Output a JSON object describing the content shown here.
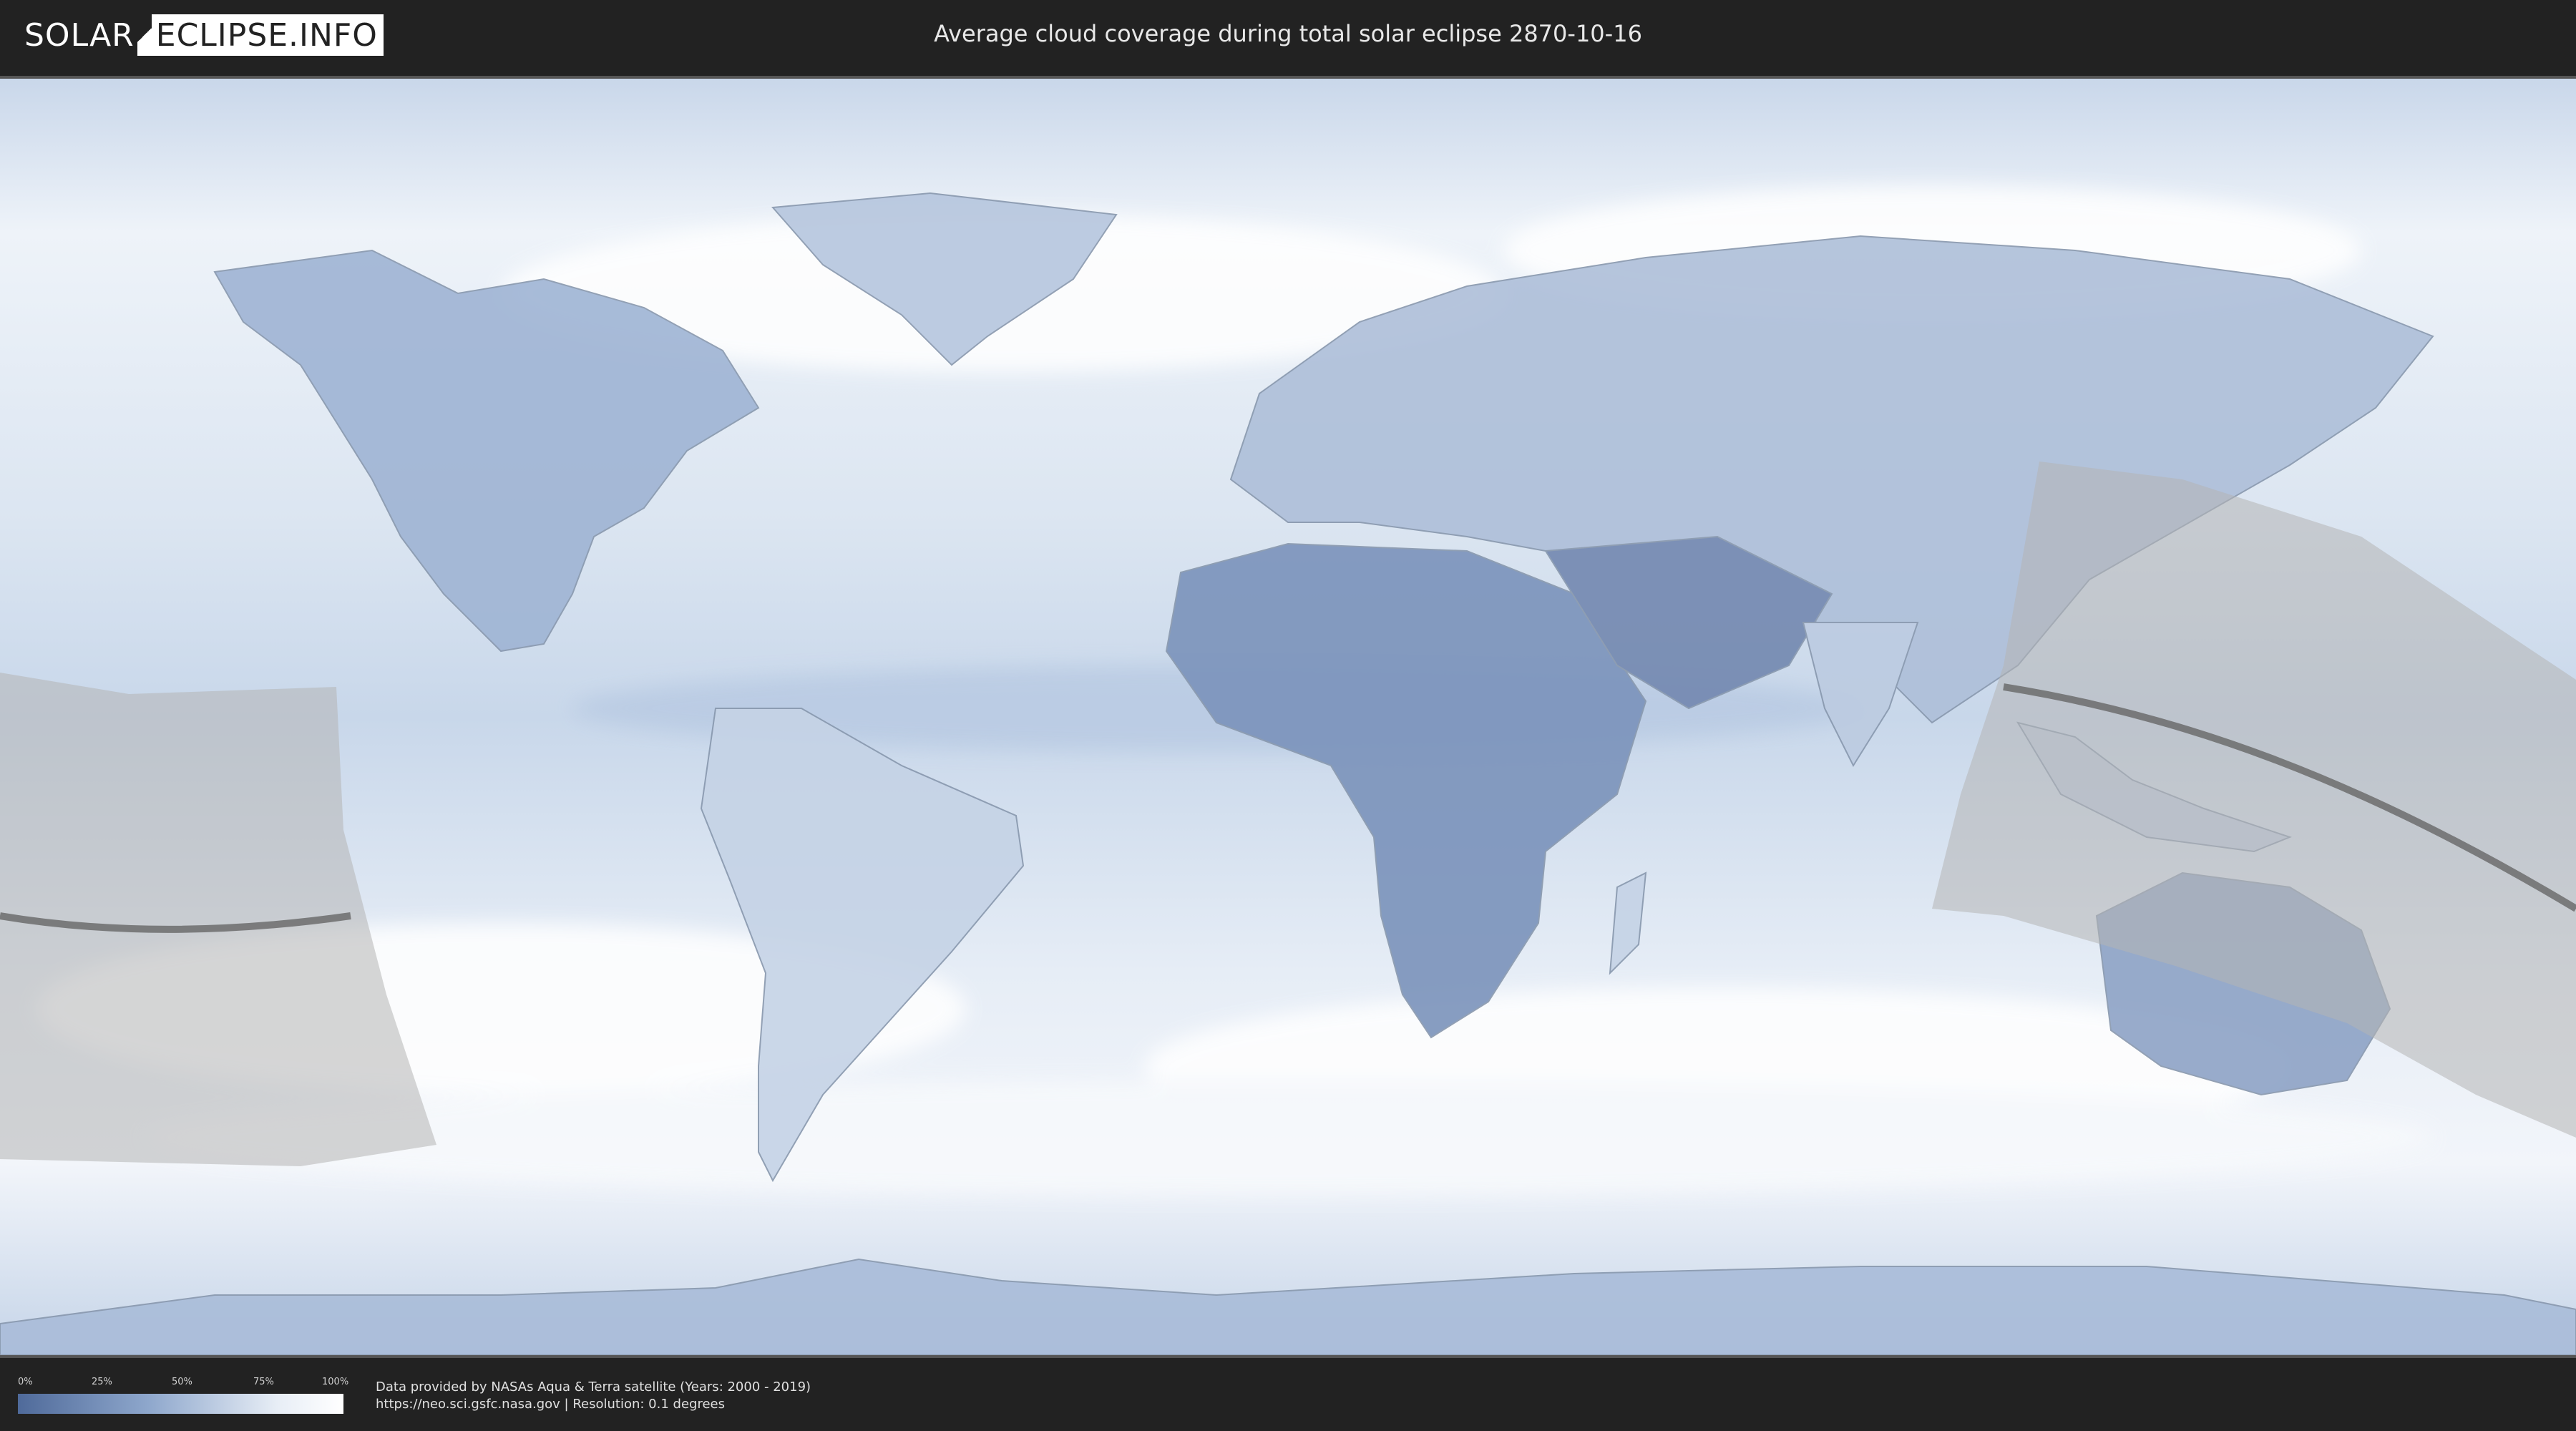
{
  "header": {
    "logo_left": "SOLAR",
    "logo_right": "ECLIPSE.INFO",
    "title": "Average cloud coverage during total solar eclipse 2870-10-16"
  },
  "map": {
    "type": "cloud-coverage-world-map",
    "eclipse_date": "2870-10-16",
    "colors": {
      "clear": "#4f6a9a",
      "cloudy": "#ffffff",
      "eclipse_zone": "#bfbfbf",
      "central_line": "#666666"
    }
  },
  "footer": {
    "legend": {
      "ticks": [
        "0%",
        "25%",
        "50%",
        "75%",
        "100%"
      ]
    },
    "credit_line1": "Data provided by NASAs Aqua & Terra satellite (Years: 2000 - 2019)",
    "credit_line2": "https://neo.sci.gsfc.nasa.gov | Resolution: 0.1 degrees"
  }
}
